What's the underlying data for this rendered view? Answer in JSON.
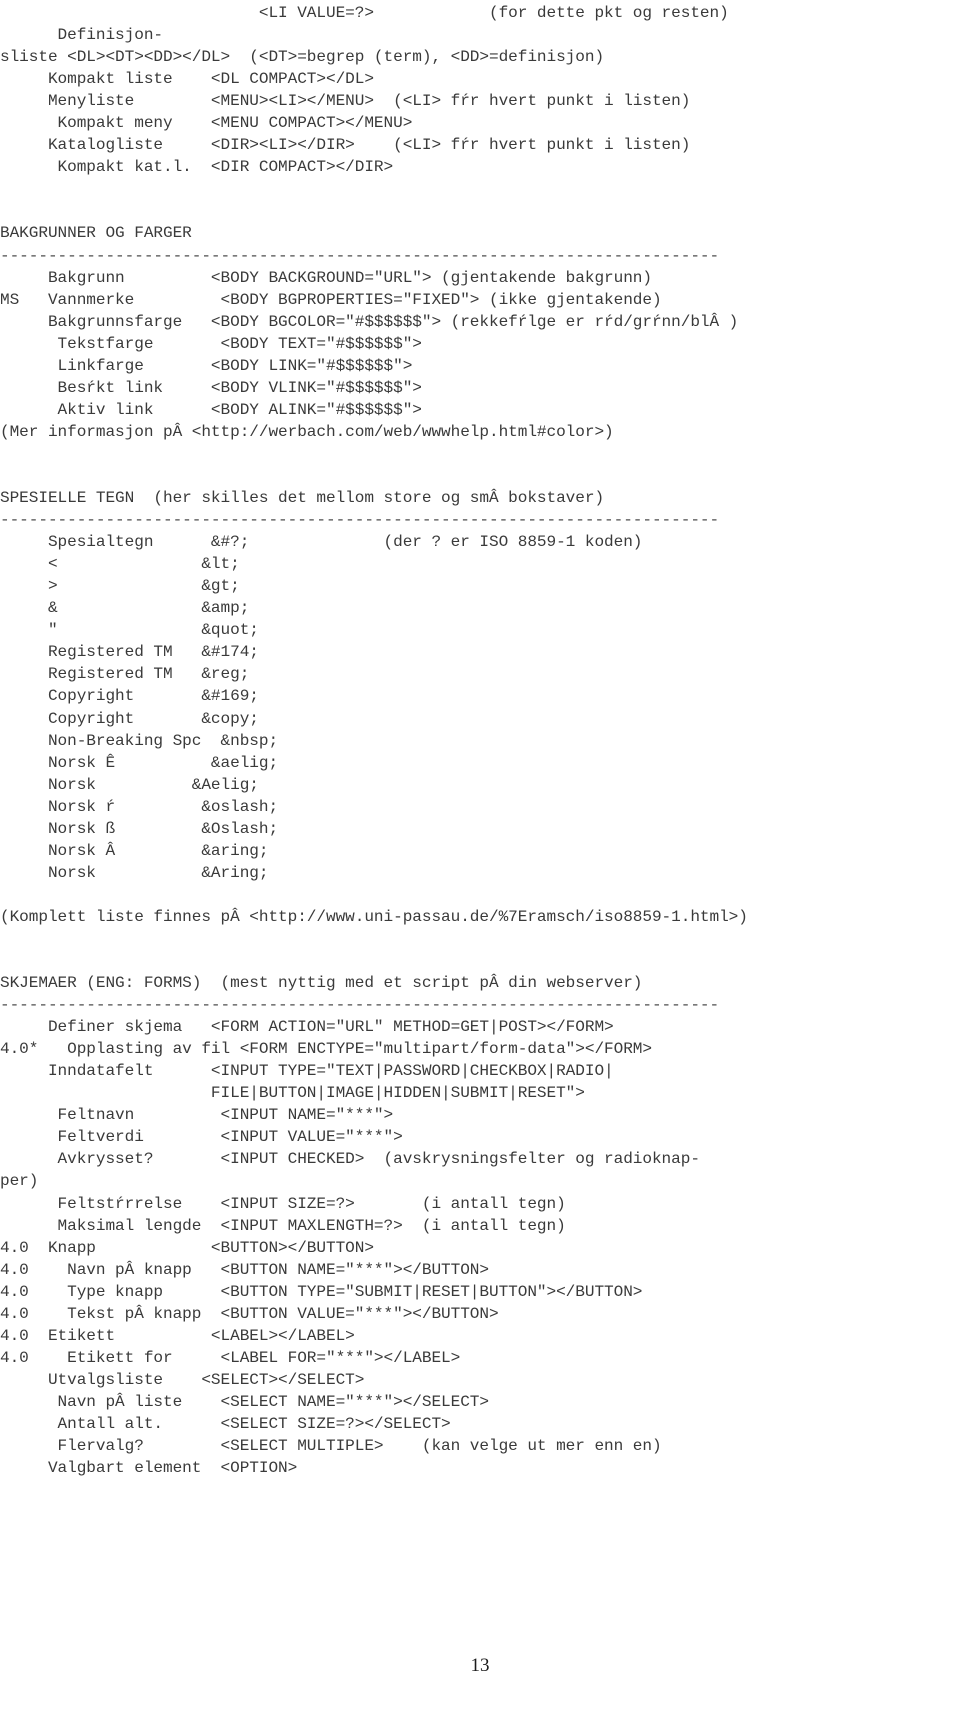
{
  "document": {
    "page_number": "13",
    "lines": [
      "                           <LI VALUE=?>            (for dette pkt og resten)",
      "      Definisjon-",
      "sliste <DL><DT><DD></DL>  (<DT>=begrep (term), <DD>=definisjon)",
      "     Kompakt liste    <DL COMPACT></DL>",
      "     Menyliste        <MENU><LI></MENU>  (<LI> fŕr hvert punkt i listen)",
      "      Kompakt meny    <MENU COMPACT></MENU>",
      "     Katalogliste     <DIR><LI></DIR>    (<LI> fŕr hvert punkt i listen)",
      "      Kompakt kat.l.  <DIR COMPACT></DIR>",
      "",
      "",
      "BAKGRUNNER OG FARGER",
      "---------------------------------------------------------------------------",
      "     Bakgrunn         <BODY BACKGROUND=\"URL\"> (gjentakende bakgrunn)",
      "MS   Vannmerke         <BODY BGPROPERTIES=\"FIXED\"> (ikke gjentakende)",
      "     Bakgrunnsfarge   <BODY BGCOLOR=\"#$$$$$$\"> (rekkefŕlge er rŕd/grŕnn/blÂ )",
      "      Tekstfarge       <BODY TEXT=\"#$$$$$$\">",
      "      Linkfarge       <BODY LINK=\"#$$$$$$\">",
      "      Besŕkt link     <BODY VLINK=\"#$$$$$$\">",
      "      Aktiv link      <BODY ALINK=\"#$$$$$$\">",
      "(Mer informasjon pÂ <http://werbach.com/web/wwwhelp.html#color>)",
      "",
      "",
      "SPESIELLE TEGN  (her skilles det mellom store og smÂ bokstaver)",
      "---------------------------------------------------------------------------",
      "     Spesialtegn      &#?;              (der ? er ISO 8859-1 koden)",
      "     <               &lt;",
      "     >               &gt;",
      "     &               &amp;",
      "     \"               &quot;",
      "     Registered TM   &#174;",
      "     Registered TM   &reg;",
      "     Copyright       &#169;",
      "     Copyright       &copy;",
      "     Non-Breaking Spc  &nbsp;",
      "     Norsk Ê          &aelig;",
      "     Norsk          &Aelig;",
      "     Norsk ŕ         &oslash;",
      "     Norsk ß         &Oslash;",
      "     Norsk Â         &aring;",
      "     Norsk           &Aring;",
      "",
      "(Komplett liste finnes pÂ <http://www.uni-passau.de/%7Eramsch/iso8859-1.html>)",
      "",
      "",
      "SKJEMAER (ENG: FORMS)  (mest nyttig med et script pÂ din webserver)",
      "---------------------------------------------------------------------------",
      "     Definer skjema   <FORM ACTION=\"URL\" METHOD=GET|POST></FORM>",
      "4.0*   Opplasting av fil <FORM ENCTYPE=\"multipart/form-data\"></FORM>",
      "     Inndatafelt      <INPUT TYPE=\"TEXT|PASSWORD|CHECKBOX|RADIO|",
      "                      FILE|BUTTON|IMAGE|HIDDEN|SUBMIT|RESET\">",
      "      Feltnavn         <INPUT NAME=\"***\">",
      "      Feltverdi        <INPUT VALUE=\"***\">",
      "      Avkrysset?       <INPUT CHECKED>  (avskrysningsfelter og radioknap-",
      "per)",
      "      Feltstŕrrelse    <INPUT SIZE=?>       (i antall tegn)",
      "      Maksimal lengde  <INPUT MAXLENGTH=?>  (i antall tegn)",
      "4.0  Knapp            <BUTTON></BUTTON>",
      "4.0    Navn pÂ knapp   <BUTTON NAME=\"***\"></BUTTON>",
      "4.0    Type knapp      <BUTTON TYPE=\"SUBMIT|RESET|BUTTON\"></BUTTON>",
      "4.0    Tekst pÂ knapp  <BUTTON VALUE=\"***\"></BUTTON>",
      "4.0  Etikett          <LABEL></LABEL>",
      "4.0    Etikett for     <LABEL FOR=\"***\"></LABEL>",
      "     Utvalgsliste    <SELECT></SELECT>",
      "      Navn pÂ liste    <SELECT NAME=\"***\"></SELECT>",
      "      Antall alt.      <SELECT SIZE=?></SELECT>",
      "      Flervalg?        <SELECT MULTIPLE>    (kan velge ut mer enn en)",
      "     Valgbart element  <OPTION>"
    ],
    "sections": [
      {
        "heading": "BAKGRUNNER OG FARGER",
        "entries": [
          {
            "version": "",
            "label": "Bakgrunn",
            "tag": "<BODY BACKGROUND=\"URL\">",
            "note": "(gjentakende bakgrunn)"
          },
          {
            "version": "MS",
            "label": "Vannmerke",
            "tag": "<BODY BGPROPERTIES=\"FIXED\">",
            "note": "(ikke gjentakende)"
          },
          {
            "version": "",
            "label": "Bakgrunnsfarge",
            "tag": "<BODY BGCOLOR=\"#$$$$$$\">",
            "note": "(rekkefŕlge er rŕd/grŕnn/blÂ )"
          },
          {
            "version": "",
            "label": "Tekstfarge",
            "tag": "<BODY TEXT=\"#$$$$$$\">",
            "note": ""
          },
          {
            "version": "",
            "label": "Linkfarge",
            "tag": "<BODY LINK=\"#$$$$$$\">",
            "note": ""
          },
          {
            "version": "",
            "label": "Besŕkt link",
            "tag": "<BODY VLINK=\"#$$$$$$\">",
            "note": ""
          },
          {
            "version": "",
            "label": "Aktiv link",
            "tag": "<BODY ALINK=\"#$$$$$$\">",
            "note": ""
          }
        ],
        "footnote": "(Mer informasjon pÂ <http://werbach.com/web/wwwhelp.html#color>)"
      },
      {
        "heading": "SPESIELLE TEGN  (her skilles det mellom store og smÂ bokstaver)",
        "entries": [
          {
            "version": "",
            "label": "Spesialtegn",
            "tag": "&#?;",
            "note": "(der ? er ISO 8859-1 koden)"
          },
          {
            "version": "",
            "label": "<",
            "tag": "&lt;",
            "note": ""
          },
          {
            "version": "",
            "label": ">",
            "tag": "&gt;",
            "note": ""
          },
          {
            "version": "",
            "label": "&",
            "tag": "&amp;",
            "note": ""
          },
          {
            "version": "",
            "label": "\"",
            "tag": "&quot;",
            "note": ""
          },
          {
            "version": "",
            "label": "Registered TM",
            "tag": "&#174;",
            "note": ""
          },
          {
            "version": "",
            "label": "Registered TM",
            "tag": "&reg;",
            "note": ""
          },
          {
            "version": "",
            "label": "Copyright",
            "tag": "&#169;",
            "note": ""
          },
          {
            "version": "",
            "label": "Copyright",
            "tag": "&copy;",
            "note": ""
          },
          {
            "version": "",
            "label": "Non-Breaking Spc",
            "tag": "&nbsp;",
            "note": ""
          },
          {
            "version": "",
            "label": "Norsk Ê",
            "tag": "&aelig;",
            "note": ""
          },
          {
            "version": "",
            "label": "Norsk",
            "tag": "&Aelig;",
            "note": ""
          },
          {
            "version": "",
            "label": "Norsk ŕ",
            "tag": "&oslash;",
            "note": ""
          },
          {
            "version": "",
            "label": "Norsk ß",
            "tag": "&Oslash;",
            "note": ""
          },
          {
            "version": "",
            "label": "Norsk Â",
            "tag": "&aring;",
            "note": ""
          },
          {
            "version": "",
            "label": "Norsk",
            "tag": "&Aring;",
            "note": ""
          }
        ],
        "footnote": "(Komplett liste finnes pÂ <http://www.uni-passau.de/%7Eramsch/iso8859-1.html>)"
      },
      {
        "heading": "SKJEMAER (ENG: FORMS)  (mest nyttig med et script pÂ din webserver)",
        "entries": [
          {
            "version": "",
            "label": "Definer skjema",
            "tag": "<FORM ACTION=\"URL\" METHOD=GET|POST></FORM>",
            "note": ""
          },
          {
            "version": "4.0*",
            "label": "Opplasting av fil",
            "tag": "<FORM ENCTYPE=\"multipart/form-data\"></FORM>",
            "note": ""
          },
          {
            "version": "",
            "label": "Inndatafelt",
            "tag": "<INPUT TYPE=\"TEXT|PASSWORD|CHECKBOX|RADIO|FILE|BUTTON|IMAGE|HIDDEN|SUBMIT|RESET\">",
            "note": ""
          },
          {
            "version": "",
            "label": "Feltnavn",
            "tag": "<INPUT NAME=\"***\">",
            "note": ""
          },
          {
            "version": "",
            "label": "Feltverdi",
            "tag": "<INPUT VALUE=\"***\">",
            "note": ""
          },
          {
            "version": "",
            "label": "Avkrysset?",
            "tag": "<INPUT CHECKED>",
            "note": "(avskrysningsfelter og radioknapper)"
          },
          {
            "version": "",
            "label": "Feltstŕrrelse",
            "tag": "<INPUT SIZE=?>",
            "note": "(i antall tegn)"
          },
          {
            "version": "",
            "label": "Maksimal lengde",
            "tag": "<INPUT MAXLENGTH=?>",
            "note": "(i antall tegn)"
          },
          {
            "version": "4.0",
            "label": "Knapp",
            "tag": "<BUTTON></BUTTON>",
            "note": ""
          },
          {
            "version": "4.0",
            "label": "Navn pÂ knapp",
            "tag": "<BUTTON NAME=\"***\"></BUTTON>",
            "note": ""
          },
          {
            "version": "4.0",
            "label": "Type knapp",
            "tag": "<BUTTON TYPE=\"SUBMIT|RESET|BUTTON\"></BUTTON>",
            "note": ""
          },
          {
            "version": "4.0",
            "label": "Tekst pÂ knapp",
            "tag": "<BUTTON VALUE=\"***\"></BUTTON>",
            "note": ""
          },
          {
            "version": "4.0",
            "label": "Etikett",
            "tag": "<LABEL></LABEL>",
            "note": ""
          },
          {
            "version": "4.0",
            "label": "Etikett for",
            "tag": "<LABEL FOR=\"***\"></LABEL>",
            "note": ""
          },
          {
            "version": "",
            "label": "Utvalgsliste",
            "tag": "<SELECT></SELECT>",
            "note": ""
          },
          {
            "version": "",
            "label": "Navn pÂ liste",
            "tag": "<SELECT NAME=\"***\"></SELECT>",
            "note": ""
          },
          {
            "version": "",
            "label": "Antall alt.",
            "tag": "<SELECT SIZE=?></SELECT>",
            "note": ""
          },
          {
            "version": "",
            "label": "Flervalg?",
            "tag": "<SELECT MULTIPLE>",
            "note": "(kan velge ut mer enn en)"
          },
          {
            "version": "",
            "label": "Valgbart element",
            "tag": "<OPTION>",
            "note": ""
          }
        ],
        "footnote": ""
      }
    ],
    "top_fragment": {
      "entries": [
        {
          "version": "",
          "label": "",
          "tag": "<LI VALUE=?>",
          "note": "(for dette pkt og resten)"
        },
        {
          "version": "",
          "label": "Definisjonsliste",
          "tag": "<DL><DT><DD></DL>",
          "note": "(<DT>=begrep (term), <DD>=definisjon)"
        },
        {
          "version": "",
          "label": "Kompakt liste",
          "tag": "<DL COMPACT></DL>",
          "note": ""
        },
        {
          "version": "",
          "label": "Menyliste",
          "tag": "<MENU><LI></MENU>",
          "note": "(<LI> fŕr hvert punkt i listen)"
        },
        {
          "version": "",
          "label": "Kompakt meny",
          "tag": "<MENU COMPACT></MENU>",
          "note": ""
        },
        {
          "version": "",
          "label": "Katalogliste",
          "tag": "<DIR><LI></DIR>",
          "note": "(<LI> fŕr hvert punkt i listen)"
        },
        {
          "version": "",
          "label": "Kompakt kat.l.",
          "tag": "<DIR COMPACT></DIR>",
          "note": ""
        }
      ]
    }
  }
}
